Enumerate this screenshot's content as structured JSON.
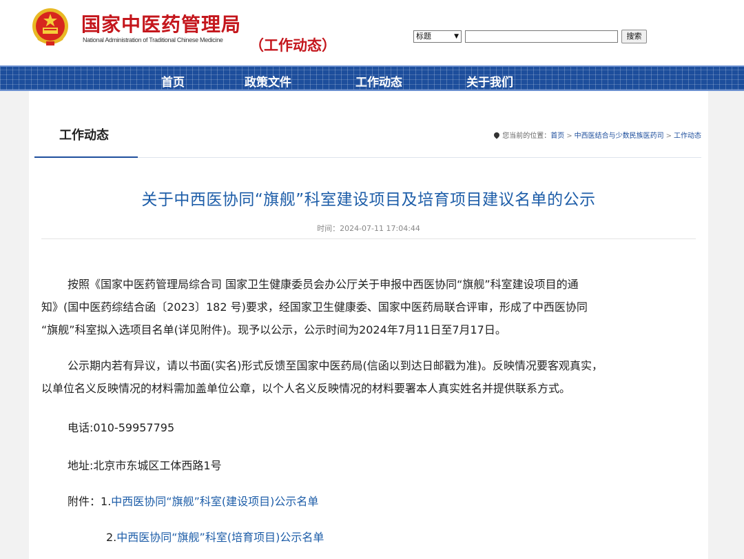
{
  "header": {
    "site_title": "国家中医药管理局",
    "site_subtitle": "National Administration of Traditional Chinese Medicine",
    "channel_title": "（工作动态）",
    "search": {
      "select_value": "标题",
      "input_value": "",
      "button_label": "搜索"
    }
  },
  "nav": {
    "items": [
      {
        "label": "首页"
      },
      {
        "label": "政策文件"
      },
      {
        "label": "工作动态"
      },
      {
        "label": "关于我们"
      }
    ]
  },
  "section": {
    "title": "工作动态",
    "breadcrumb": {
      "prefix": "您当前的位置：",
      "items": [
        "首页",
        "中西医结合与少数民族医药司",
        "工作动态"
      ],
      "separator": ">"
    }
  },
  "article": {
    "title": "关于中西医协同“旗舰”科室建设项目及培育项目建议名单的公示",
    "time": "时间：2024-07-11 17:04:44",
    "para1_lines": [
      "按照《国家中医药管理局综合司 国家卫生健康委员会办公厅关于申报中西医协同“旗舰”科室建设项目的通",
      "知》(国中医药综结合函〔2023〕182 号)要求，经国家卫生健康委、国家中医药局联合评审，形成了中西医协同",
      "“旗舰”科室拟入选项目名单(详见附件)。现予以公示，公示时间为2024年7月11日至7月17日。"
    ],
    "para2_lines": [
      "公示期内若有异议，请以书面(实名)形式反馈至国家中医药局(信函以到达日邮戳为准)。反映情况要客观真实，",
      "以单位名义反映情况的材料需加盖单位公章，以个人名义反映情况的材料要署本人真实姓名并提供联系方式。"
    ],
    "phone": "电话:010-59957795",
    "address": "地址:北京市东城区工体西路1号",
    "attachments_label": "附件：",
    "attachments": [
      {
        "num": "1.",
        "title": "中西医协同“旗舰”科室(建设项目)公示名单"
      },
      {
        "num": "2.",
        "title": "中西医协同“旗舰”科室(培育项目)公示名单"
      }
    ]
  },
  "colors": {
    "brand_red": "#c4161c",
    "nav_blue": "#1d4e9c",
    "link_blue": "#1d5da8",
    "emblem_gold": "#e8b925"
  },
  "icons": [
    "national-emblem-icon",
    "location-pin-icon",
    "chevron-down-icon"
  ]
}
